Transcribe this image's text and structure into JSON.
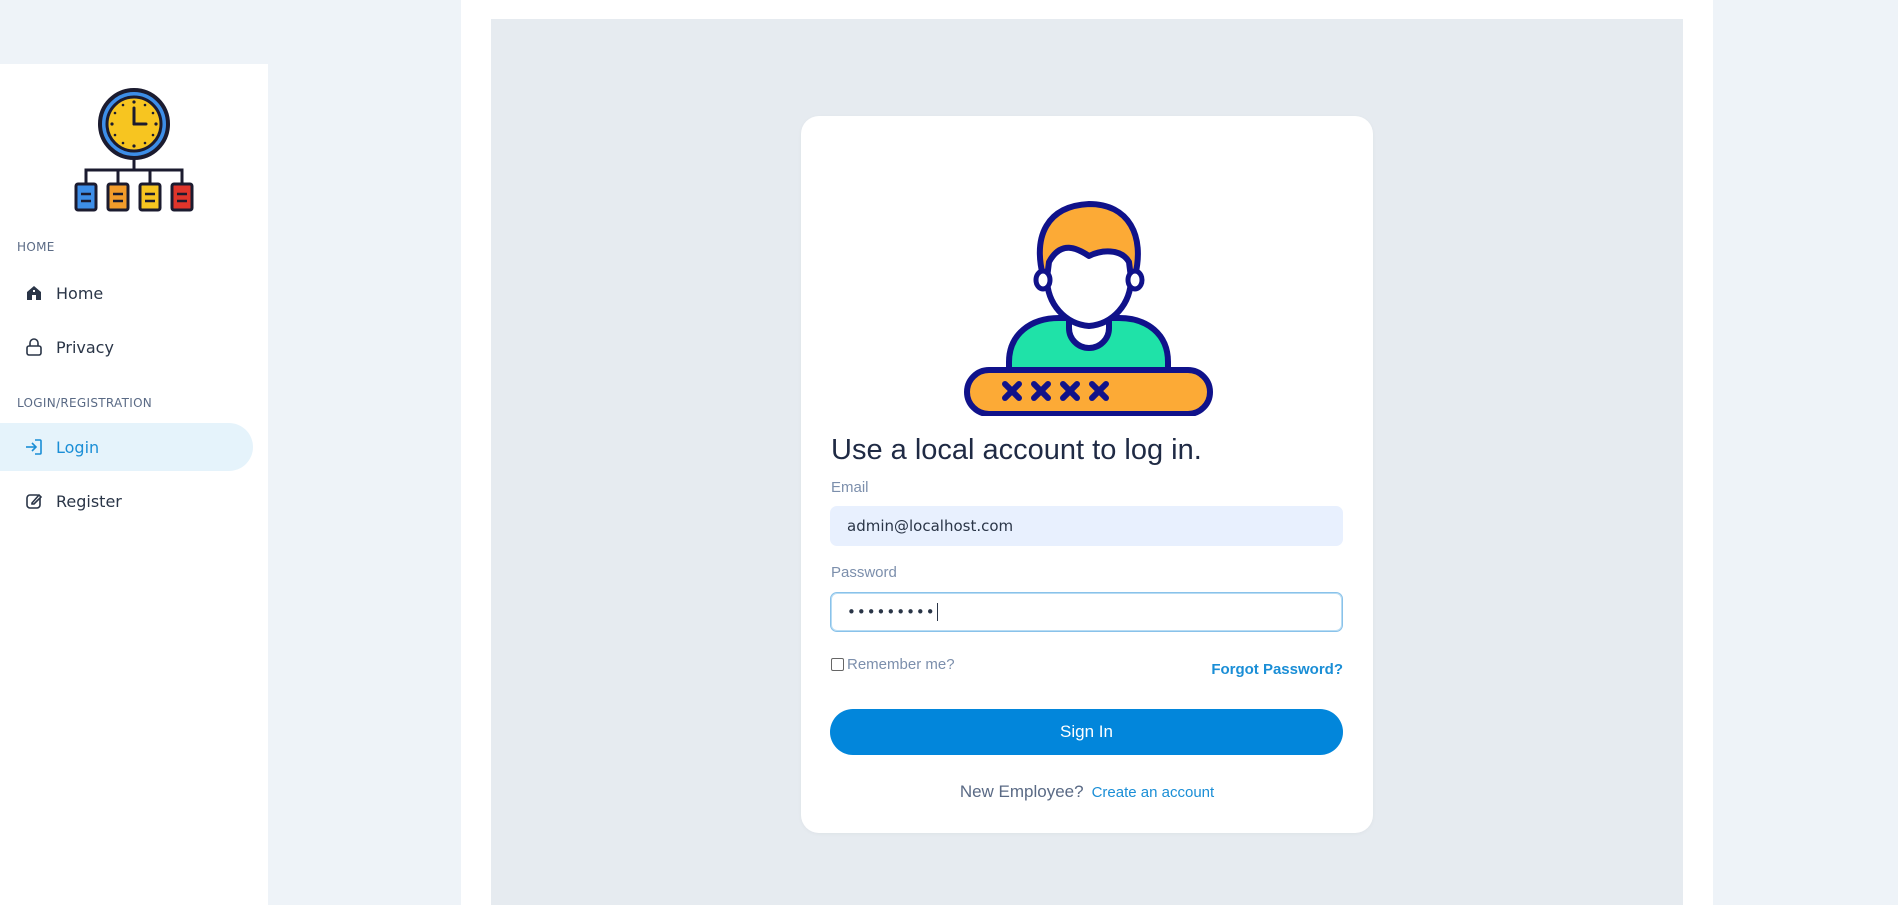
{
  "sidebar": {
    "logo_icon": "org-chart-clock-icon",
    "sections": [
      {
        "label": "HOME",
        "items": [
          {
            "label": "Home",
            "icon": "home-icon"
          },
          {
            "label": "Privacy",
            "icon": "lock-icon"
          }
        ]
      },
      {
        "label": "LOGIN/REGISTRATION",
        "items": [
          {
            "label": "Login",
            "icon": "login-icon",
            "active": true
          },
          {
            "label": "Register",
            "icon": "edit-icon"
          }
        ]
      }
    ]
  },
  "login": {
    "hero_icon": "user-password-icon",
    "title": "Use a local account to log in.",
    "email_label": "Email",
    "email_value": "admin@localhost.com",
    "password_label": "Password",
    "password_value": "•••••••••",
    "remember_label": "Remember me?",
    "remember_checked": false,
    "forgot_label": "Forgot Password?",
    "signin_label": "Sign In",
    "new_employee_text": "New Employee?",
    "create_account_label": "Create an account"
  },
  "colors": {
    "accent": "#0286db",
    "link": "#1a8ed6",
    "active_nav_bg": "#e5f3fb",
    "page_bg": "#eef3f8",
    "panel_bg": "#e6ebf0"
  }
}
